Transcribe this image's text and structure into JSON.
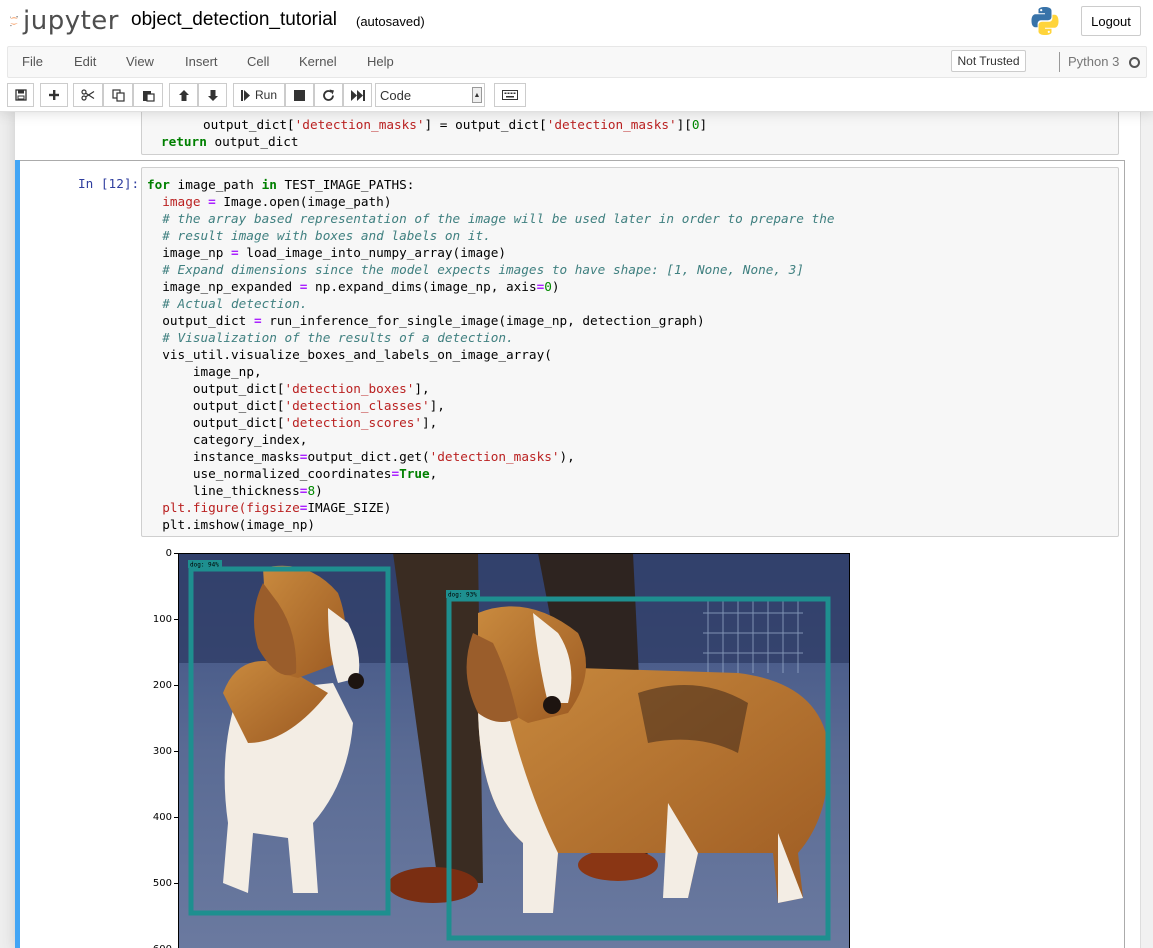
{
  "header": {
    "logo_text": "jupyter",
    "notebook_name": "object_detection_tutorial",
    "save_status": "(autosaved)",
    "logout_label": "Logout"
  },
  "menubar": {
    "items": [
      "File",
      "Edit",
      "View",
      "Insert",
      "Cell",
      "Kernel",
      "Help"
    ],
    "trust_label": "Not Trusted",
    "kernel_name": "Python 3"
  },
  "toolbar": {
    "run_label": "Run",
    "cell_type": "Code",
    "icons": [
      "save-icon",
      "plus-icon",
      "cut-icon",
      "copy-icon",
      "paste-icon",
      "arrow-up-icon",
      "arrow-down-icon",
      "run-icon",
      "stop-icon",
      "restart-icon",
      "fast-forward-icon",
      "keyboard-icon"
    ]
  },
  "prev_cell": {
    "line1_a": "output_dict[",
    "line1_s1": "'detection_masks'",
    "line1_b": "] = output_dict[",
    "line1_s2": "'detection_masks'",
    "line1_c": "][",
    "line1_n": "0",
    "line1_d": "]",
    "line2_kw": "return",
    "line2_rest": " output_dict"
  },
  "cell": {
    "prompt": "In [12]:",
    "lines": {
      "l1_kw1": "for",
      "l1_a": " image_path ",
      "l1_kw2": "in",
      "l1_b": " TEST_IMAGE_PATHS:",
      "l2_v": "image",
      "l2_op": " = ",
      "l2_b": "Image.open(image_path)",
      "l3": "# the array based representation of the image will be used later in order to prepare the",
      "l4": "# result image with boxes and labels on it.",
      "l5_a": "image_np ",
      "l5_op": "=",
      "l5_b": " load_image_into_numpy_array(image)",
      "l6": "# Expand dimensions since the model expects images to have shape: [1, None, None, 3]",
      "l7_a": "image_np_expanded ",
      "l7_op": "=",
      "l7_b": " np.expand_dims(image_np, axis",
      "l7_op2": "=",
      "l7_n": "0",
      "l7_c": ")",
      "l8": "# Actual detection.",
      "l9_a": "output_dict ",
      "l9_op": "=",
      "l9_b": " run_inference_for_single_image(image_np, detection_graph)",
      "l10": "# Visualization of the results of a detection.",
      "l11": "vis_util.visualize_boxes_and_labels_on_image_array(",
      "l12": "image_np,",
      "l13_a": "output_dict[",
      "l13_s": "'detection_boxes'",
      "l13_b": "],",
      "l14_a": "output_dict[",
      "l14_s": "'detection_classes'",
      "l14_b": "],",
      "l15_a": "output_dict[",
      "l15_s": "'detection_scores'",
      "l15_b": "],",
      "l16": "category_index,",
      "l17_a": "instance_masks",
      "l17_op": "=",
      "l17_b": "output_dict.get(",
      "l17_s": "'detection_masks'",
      "l17_c": "),",
      "l18_a": "use_normalized_coordinates",
      "l18_op": "=",
      "l18_kw": "True",
      "l18_c": ",",
      "l19_a": "line_thickness",
      "l19_op": "=",
      "l19_n": "8",
      "l19_c": ")",
      "l20_a": "plt",
      "l20_b": ".figure(figsize",
      "l20_op": "=",
      "l20_c": "IMAGE_SIZE)",
      "l21_a": "plt",
      "l21_b": ".imshow(image_np)"
    }
  },
  "plot": {
    "y_ticks": [
      "0",
      "100",
      "200",
      "300",
      "400",
      "500",
      "600"
    ],
    "detections": [
      {
        "label": "dog: 94%",
        "box_color": "#1e8f8f"
      },
      {
        "label": "dog: 93%",
        "box_color": "#1e8f8f"
      }
    ]
  }
}
